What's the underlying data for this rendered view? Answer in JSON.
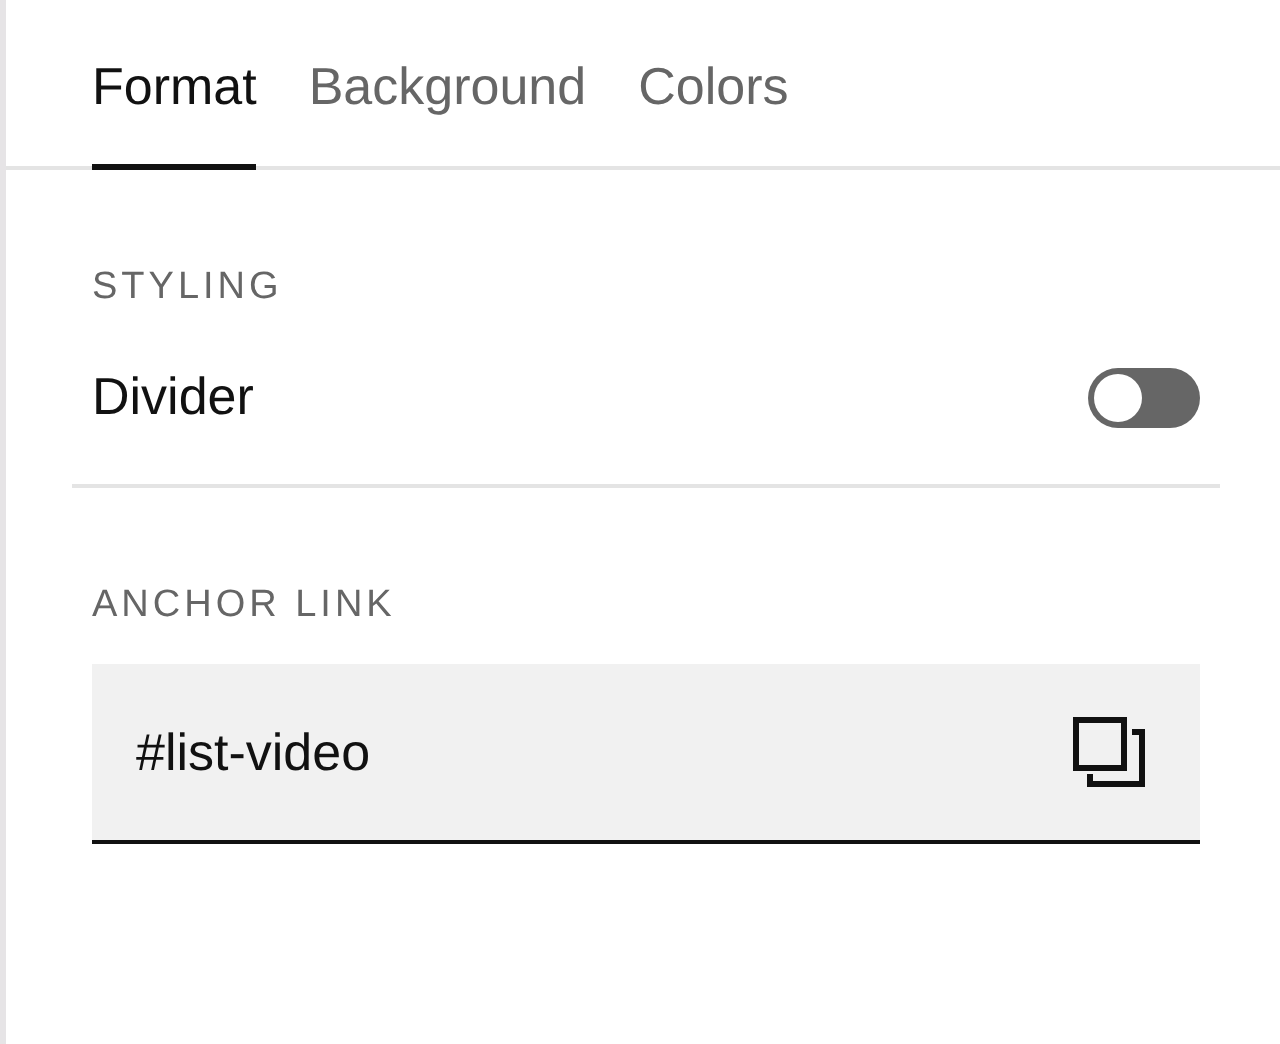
{
  "tabs": [
    {
      "label": "Format",
      "selected": true
    },
    {
      "label": "Background",
      "selected": false
    },
    {
      "label": "Colors",
      "selected": false
    }
  ],
  "sections": [
    {
      "heading": "STYLING",
      "kind": "toggle",
      "label": "Divider",
      "on": false
    },
    {
      "heading": "ANCHOR LINK",
      "kind": "field",
      "value": "#list-video"
    }
  ]
}
